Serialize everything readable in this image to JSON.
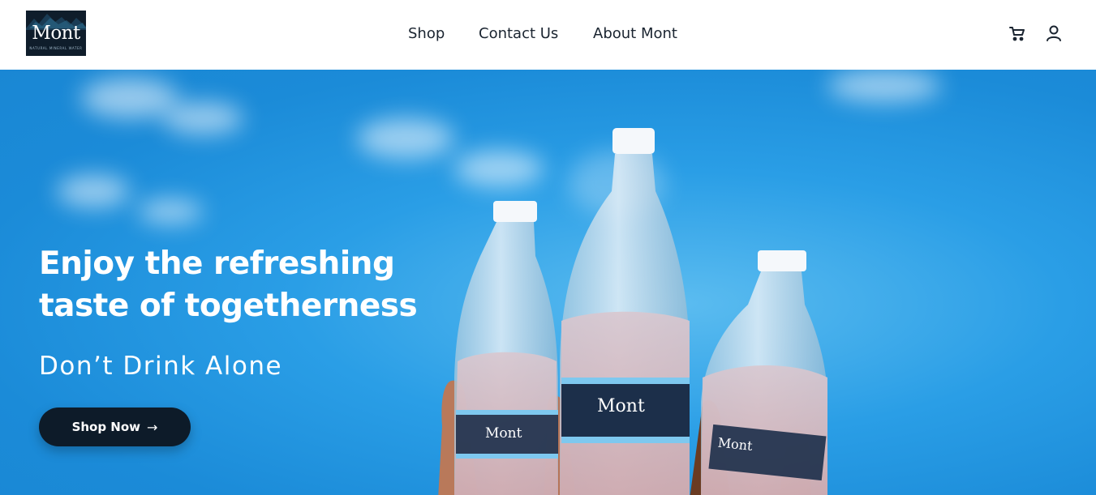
{
  "brand": {
    "logo_word": "Mont",
    "logo_tagline": "NATURAL MINERAL WATER"
  },
  "nav": {
    "items": [
      {
        "label": "Shop"
      },
      {
        "label": "Contact Us"
      },
      {
        "label": "About Mont"
      }
    ]
  },
  "header_icons": {
    "cart": "cart-icon",
    "account": "user-icon"
  },
  "hero": {
    "title_line1": "Enjoy the refreshing",
    "title_line2": "taste of togetherness",
    "subtitle": "Don’t Drink Alone",
    "cta_label": "Shop Now",
    "cta_arrow": "→",
    "bottle_label": "Mont"
  },
  "colors": {
    "header_bg": "#ffffff",
    "hero_blue": "#2a9ee6",
    "cta_bg": "#0d1b29",
    "logo_bg": "#0f1d2b"
  }
}
